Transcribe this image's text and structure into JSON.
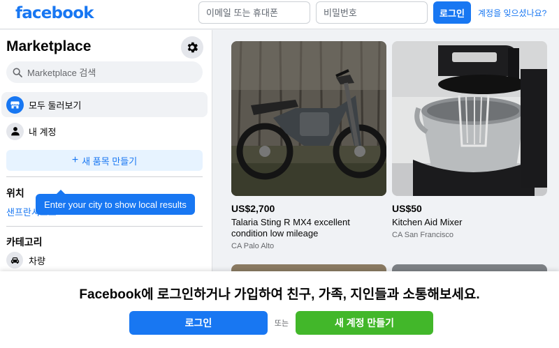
{
  "header": {
    "logo": "facebook",
    "email_placeholder": "이메일 또는 휴대폰",
    "password_placeholder": "비밀번호",
    "login_label": "로그인",
    "forgot_label": "계정을 잊으셨나요?"
  },
  "sidebar": {
    "title": "Marketplace",
    "search_placeholder": "Marketplace 검색",
    "items": [
      {
        "label": "모두 둘러보기",
        "icon": "storefront-icon",
        "active": true
      },
      {
        "label": "내 계정",
        "icon": "person-icon",
        "active": false
      }
    ],
    "create_listing": "새 품목 만들기",
    "location_heading": "위치",
    "location_city": "샌프란시스코",
    "tooltip": "Enter your city to show local results",
    "categories_heading": "카테고리",
    "category_items": [
      {
        "label": "차량",
        "icon": "car-icon"
      }
    ]
  },
  "listings": [
    {
      "price": "US$2,700",
      "title": "Talaria Sting R MX4 excellent condition low mileage",
      "location": "CA Palo Alto",
      "image": "dirt-bike-photo"
    },
    {
      "price": "US$50",
      "title": "Kitchen Aid Mixer",
      "location": "CA San Francisco",
      "image": "stand-mixer-photo"
    }
  ],
  "banner": {
    "message": "Facebook에 로그인하거나 가입하여 친구, 가족, 지인들과 소통해보세요.",
    "login_label": "로그인",
    "or_label": "또는",
    "create_account_label": "새 계정 만들기"
  },
  "colors": {
    "brand": "#1877f2",
    "create_account": "#42b72a",
    "background": "#f0f2f5"
  }
}
